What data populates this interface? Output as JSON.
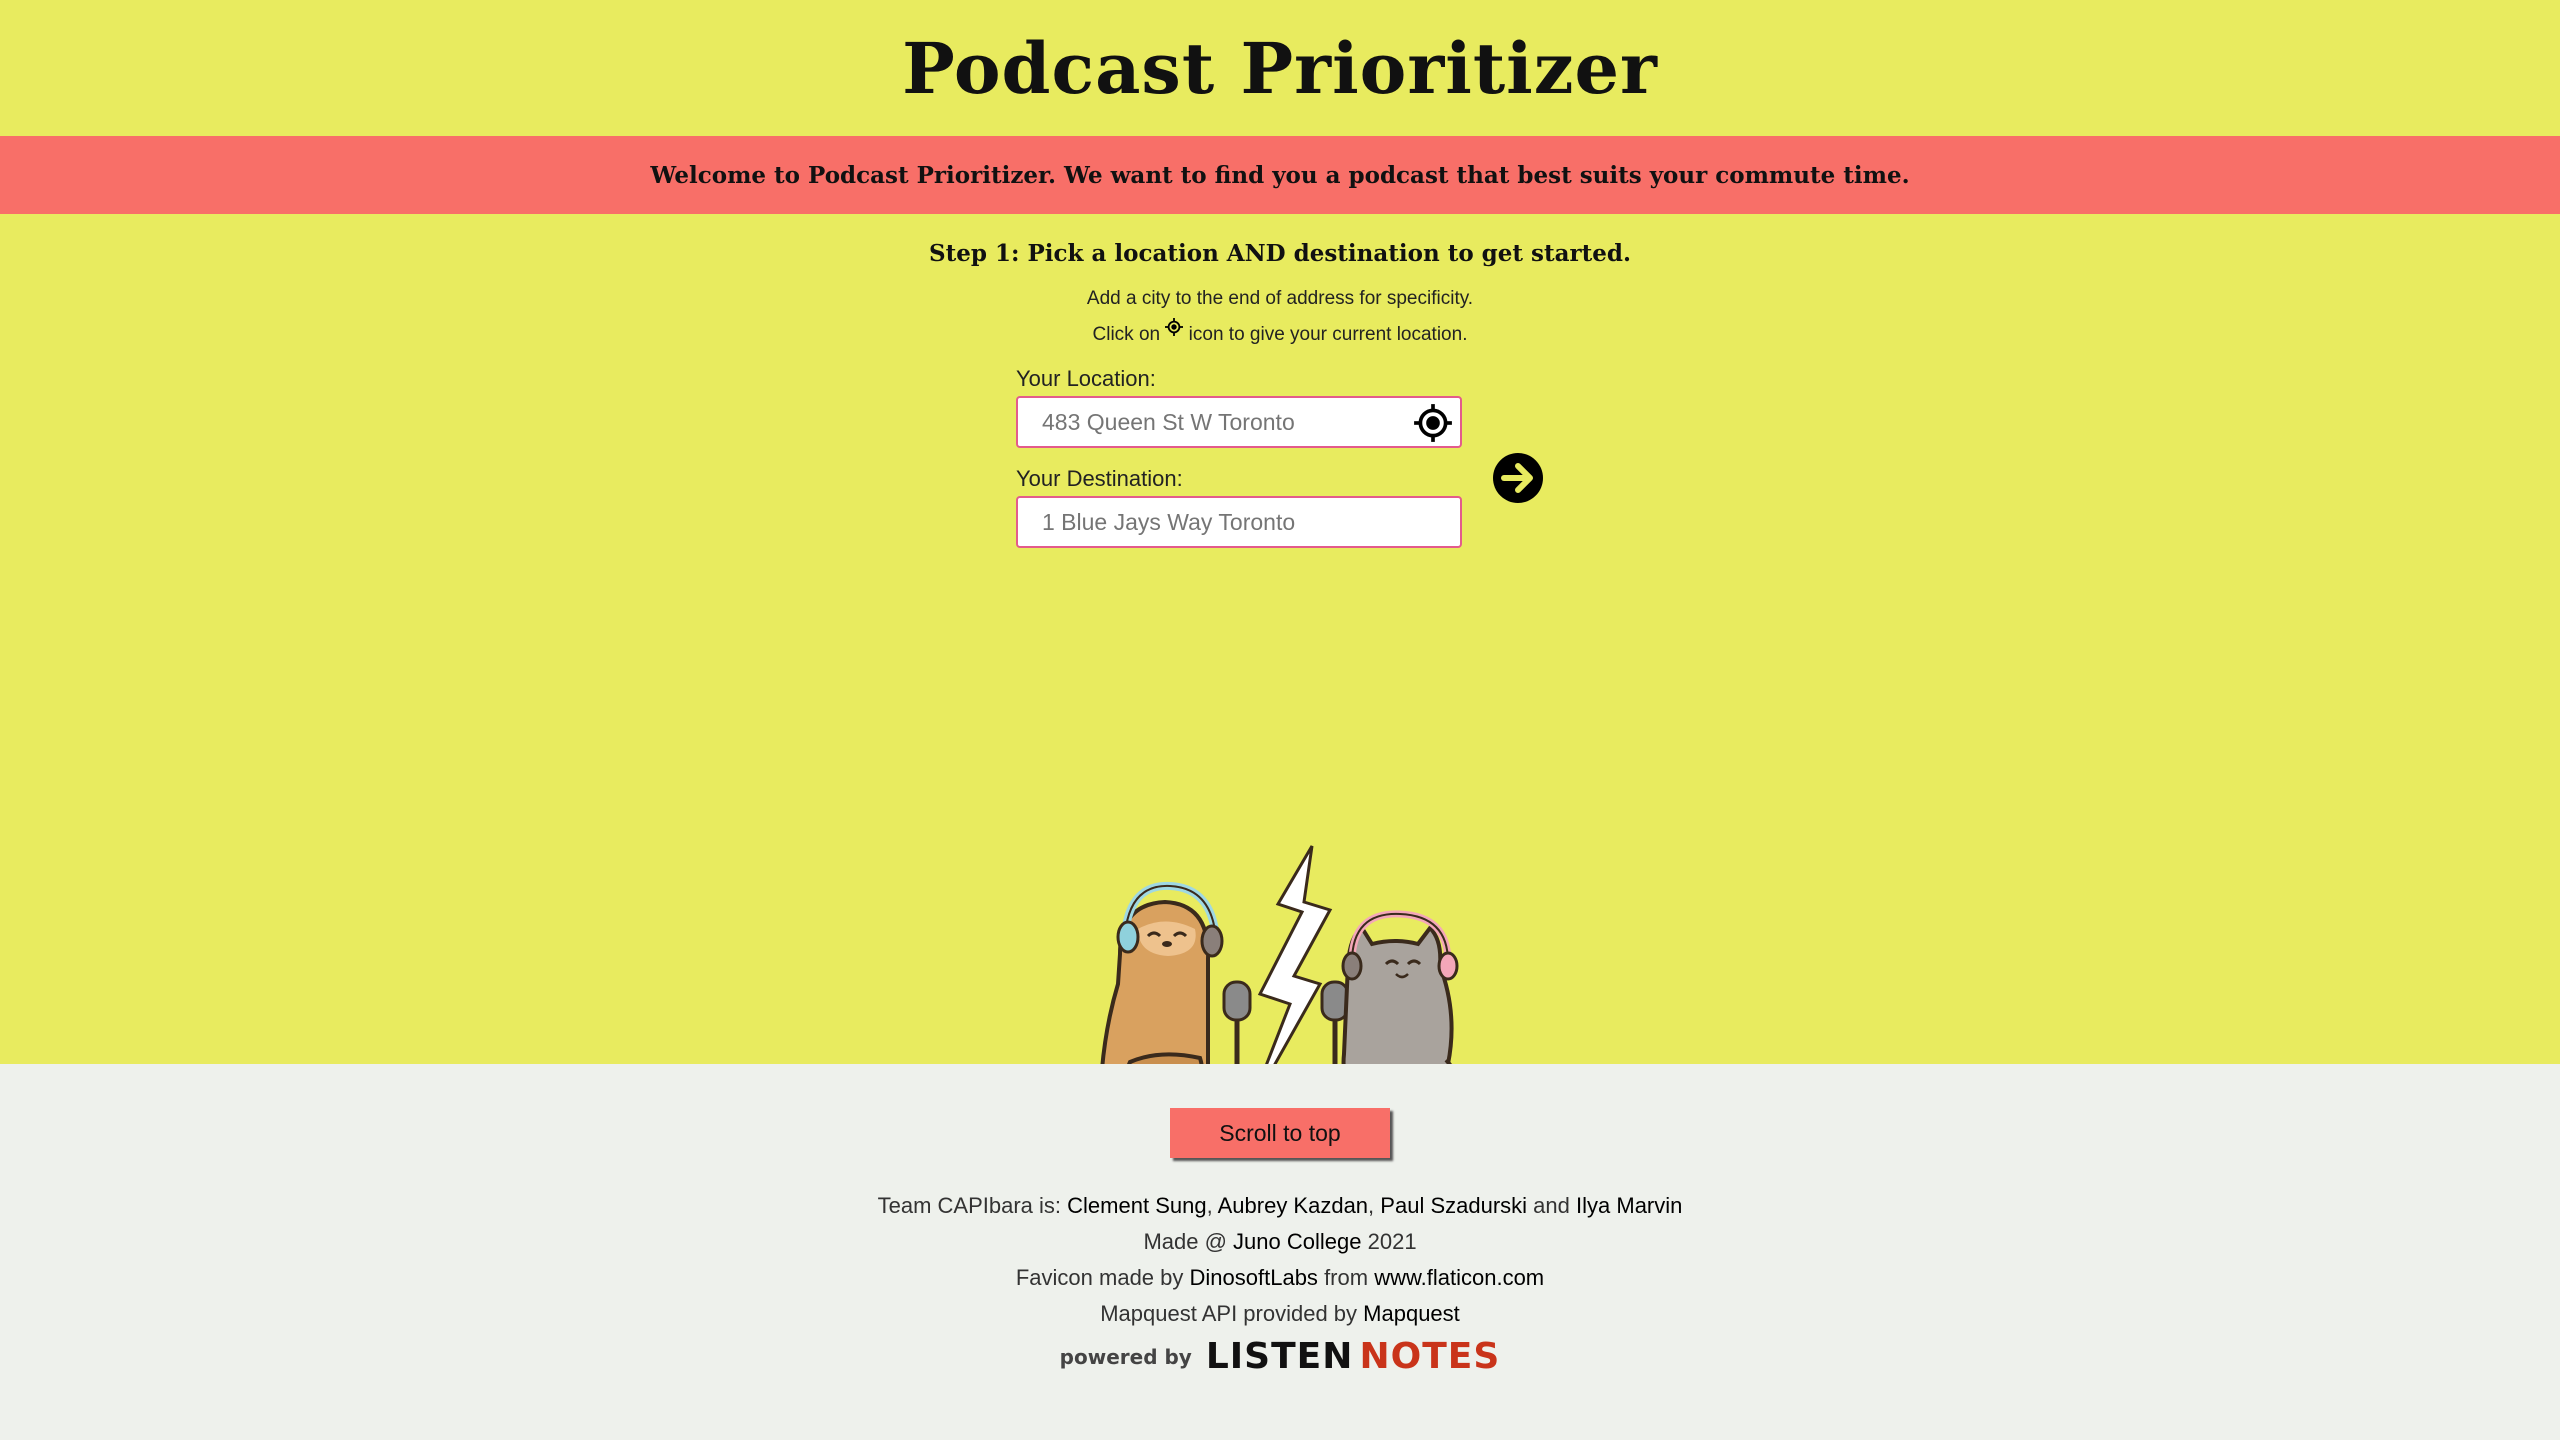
{
  "header": {
    "title": "Podcast Prioritizer"
  },
  "banner": {
    "text": "Welcome to Podcast Prioritizer. We want to find you a podcast that best suits your commute time."
  },
  "step": {
    "title": "Step 1: Pick a location AND destination to get started.",
    "hint1": "Add a city to the end of address for specificity.",
    "hint2_before": "Click on",
    "hint2_after": "icon to give your current location."
  },
  "form": {
    "location_label": "Your Location:",
    "location_placeholder": "483 Queen St W Toronto",
    "destination_label": "Your Destination:",
    "destination_placeholder": "1 Blue Jays Way Toronto"
  },
  "icons": {
    "locate": "crosshair-icon",
    "submit": "arrow-right-circle-icon"
  },
  "footer": {
    "scroll_label": "Scroll to top",
    "team_prefix": "Team CAPIbara is:",
    "members": [
      "Clement Sung",
      "Aubrey Kazdan",
      "Paul Szadurski",
      "Ilya Marvin"
    ],
    "comma": ",",
    "and": "and",
    "made_prefix": "Made @",
    "made_link": "Juno College",
    "made_year": "2021",
    "favicon_prefix": "Favicon made by",
    "favicon_author": "DinosoftLabs",
    "favicon_from": "from",
    "favicon_site": "www.flaticon.com",
    "mapquest_prefix": "Mapquest API provided by",
    "mapquest_link": "Mapquest",
    "powered_by": "powered by",
    "listen": "LISTEN",
    "notes": "NOTES"
  },
  "colors": {
    "background": "#e8eb5f",
    "banner": "#f86f68",
    "footer": "#eef1ec",
    "input_border": "#e35b8c",
    "notes_red": "#c9341a"
  }
}
